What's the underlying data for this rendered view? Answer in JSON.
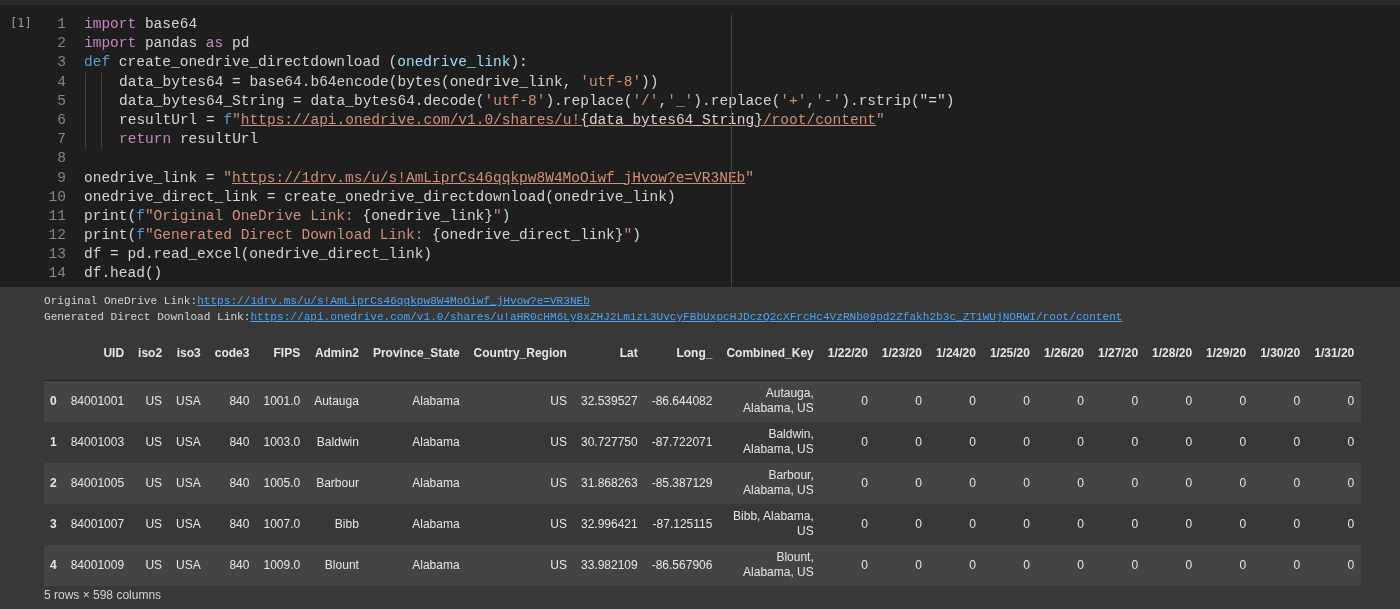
{
  "code_cell": {
    "execution_count": "[1]",
    "lines": [
      {
        "number": "1",
        "indented": false,
        "tokens": [
          {
            "kind": "keyword",
            "text": "import"
          },
          {
            "kind": "plain",
            "text": " base64"
          }
        ]
      },
      {
        "number": "2",
        "indented": false,
        "tokens": [
          {
            "kind": "keyword",
            "text": "import"
          },
          {
            "kind": "plain",
            "text": " pandas "
          },
          {
            "kind": "keyword",
            "text": "as"
          },
          {
            "kind": "plain",
            "text": " pd"
          }
        ]
      },
      {
        "number": "3",
        "indented": false,
        "tokens": [
          {
            "kind": "def",
            "text": "def"
          },
          {
            "kind": "plain",
            "text": " create_onedrive_directdownload ("
          },
          {
            "kind": "param",
            "text": "onedrive_link"
          },
          {
            "kind": "plain",
            "text": "):"
          }
        ]
      },
      {
        "number": "4",
        "indented": true,
        "tokens": [
          {
            "kind": "plain",
            "text": "data_bytes64 = base64.b64encode(bytes(onedrive_link, "
          },
          {
            "kind": "string",
            "text": "'utf-8'"
          },
          {
            "kind": "plain",
            "text": "))"
          }
        ]
      },
      {
        "number": "5",
        "indented": true,
        "tokens": [
          {
            "kind": "plain",
            "text": "data_bytes64_String = data_bytes64.decode("
          },
          {
            "kind": "string",
            "text": "'utf-8'"
          },
          {
            "kind": "plain",
            "text": ").replace("
          },
          {
            "kind": "string",
            "text": "'/'"
          },
          {
            "kind": "plain",
            "text": ","
          },
          {
            "kind": "string",
            "text": "'_'"
          },
          {
            "kind": "plain",
            "text": ").replace("
          },
          {
            "kind": "string",
            "text": "'+'"
          },
          {
            "kind": "plain",
            "text": ","
          },
          {
            "kind": "string",
            "text": "'-'"
          },
          {
            "kind": "plain",
            "text": ").rstrip(\"=\")"
          }
        ]
      },
      {
        "number": "6",
        "indented": true,
        "tokens": [
          {
            "kind": "plain",
            "text": "resultUrl = "
          },
          {
            "kind": "def",
            "text": "f"
          },
          {
            "kind": "string",
            "text": "\""
          },
          {
            "kind": "link-string",
            "text": "https://api.onedrive.com/v1.0/shares/u!"
          },
          {
            "kind": "link-plain",
            "text": "{data_bytes64_String}"
          },
          {
            "kind": "link-string",
            "text": "/root/content"
          },
          {
            "kind": "string",
            "text": "\""
          }
        ]
      },
      {
        "number": "7",
        "indented": true,
        "tokens": [
          {
            "kind": "keyword",
            "text": "return"
          },
          {
            "kind": "plain",
            "text": " resultUrl"
          }
        ]
      },
      {
        "number": "8",
        "indented": false
      },
      {
        "number": "9",
        "indented": false,
        "tokens": [
          {
            "kind": "plain",
            "text": "onedrive_link = "
          },
          {
            "kind": "string",
            "text": "\""
          },
          {
            "kind": "link-string",
            "text": "https://1drv.ms/u/s!AmLiprCs46qqkpw8W4MoOiwf_jHvow?e=VR3NEb"
          },
          {
            "kind": "string",
            "text": "\""
          }
        ]
      },
      {
        "number": "10",
        "indented": false,
        "tokens": [
          {
            "kind": "plain",
            "text": "onedrive_direct_link = create_onedrive_directdownload(onedrive_link)"
          }
        ]
      },
      {
        "number": "11",
        "indented": false,
        "tokens": [
          {
            "kind": "plain",
            "text": "print("
          },
          {
            "kind": "def",
            "text": "f"
          },
          {
            "kind": "string",
            "text": "\"Original OneDrive Link: "
          },
          {
            "kind": "plain",
            "text": "{onedrive_link}"
          },
          {
            "kind": "string",
            "text": "\""
          },
          {
            "kind": "plain",
            "text": ")"
          }
        ]
      },
      {
        "number": "12",
        "indented": false,
        "tokens": [
          {
            "kind": "plain",
            "text": "print("
          },
          {
            "kind": "def",
            "text": "f"
          },
          {
            "kind": "string",
            "text": "\"Generated Direct Download Link: "
          },
          {
            "kind": "plain",
            "text": "{onedrive_direct_link}"
          },
          {
            "kind": "string",
            "text": "\""
          },
          {
            "kind": "plain",
            "text": ")"
          }
        ]
      },
      {
        "number": "13",
        "indented": false,
        "tokens": [
          {
            "kind": "plain",
            "text": "df = pd.read_excel(onedrive_direct_link)"
          }
        ]
      },
      {
        "number": "14",
        "indented": false,
        "tokens": [
          {
            "kind": "plain",
            "text": "df.head()"
          }
        ]
      }
    ]
  },
  "output": {
    "lines": [
      {
        "label": "Original OneDrive Link: ",
        "link": "https://1drv.ms/u/s!AmLiprCs46qqkpw8W4MoOiwf_jHvow?e=VR3NEb"
      },
      {
        "label": "Generated Direct Download Link: ",
        "link": "https://api.onedrive.com/v1.0/shares/u!aHR0cHM6Ly8xZHJ2Lm1zL3UvcyFBbUxpcHJDczQ2cXFrcHc4VzRNb09pd2Zfakh2b3c_ZT1WUjNORWI/root/content"
      }
    ],
    "table": {
      "columns": [
        "UID",
        "iso2",
        "iso3",
        "code3",
        "FIPS",
        "Admin2",
        "Province_State",
        "Country_Region",
        "Lat",
        "Long_",
        "Combined_Key",
        "1/22/20",
        "1/23/20",
        "1/24/20",
        "1/25/20",
        "1/26/20",
        "1/27/20",
        "1/28/20",
        "1/29/20",
        "1/30/20",
        "1/31/20"
      ],
      "rows": [
        {
          "index": "0",
          "cells": [
            "84001001",
            "US",
            "USA",
            "840",
            "1001.0",
            "Autauga",
            "Alabama",
            "US",
            "32.539527",
            "-86.644082",
            "Autauga, Alabama, US",
            "0",
            "0",
            "0",
            "0",
            "0",
            "0",
            "0",
            "0",
            "0",
            "0"
          ]
        },
        {
          "index": "1",
          "cells": [
            "84001003",
            "US",
            "USA",
            "840",
            "1003.0",
            "Baldwin",
            "Alabama",
            "US",
            "30.727750",
            "-87.722071",
            "Baldwin, Alabama, US",
            "0",
            "0",
            "0",
            "0",
            "0",
            "0",
            "0",
            "0",
            "0",
            "0"
          ]
        },
        {
          "index": "2",
          "cells": [
            "84001005",
            "US",
            "USA",
            "840",
            "1005.0",
            "Barbour",
            "Alabama",
            "US",
            "31.868263",
            "-85.387129",
            "Barbour, Alabama, US",
            "0",
            "0",
            "0",
            "0",
            "0",
            "0",
            "0",
            "0",
            "0",
            "0"
          ]
        },
        {
          "index": "3",
          "cells": [
            "84001007",
            "US",
            "USA",
            "840",
            "1007.0",
            "Bibb",
            "Alabama",
            "US",
            "32.996421",
            "-87.125115",
            "Bibb, Alabama, US",
            "0",
            "0",
            "0",
            "0",
            "0",
            "0",
            "0",
            "0",
            "0",
            "0"
          ]
        },
        {
          "index": "4",
          "cells": [
            "84001009",
            "US",
            "USA",
            "840",
            "1009.0",
            "Blount",
            "Alabama",
            "US",
            "33.982109",
            "-86.567906",
            "Blount, Alabama, US",
            "0",
            "0",
            "0",
            "0",
            "0",
            "0",
            "0",
            "0",
            "0",
            "0"
          ]
        }
      ]
    },
    "summary": "5 rows × 598 columns"
  }
}
